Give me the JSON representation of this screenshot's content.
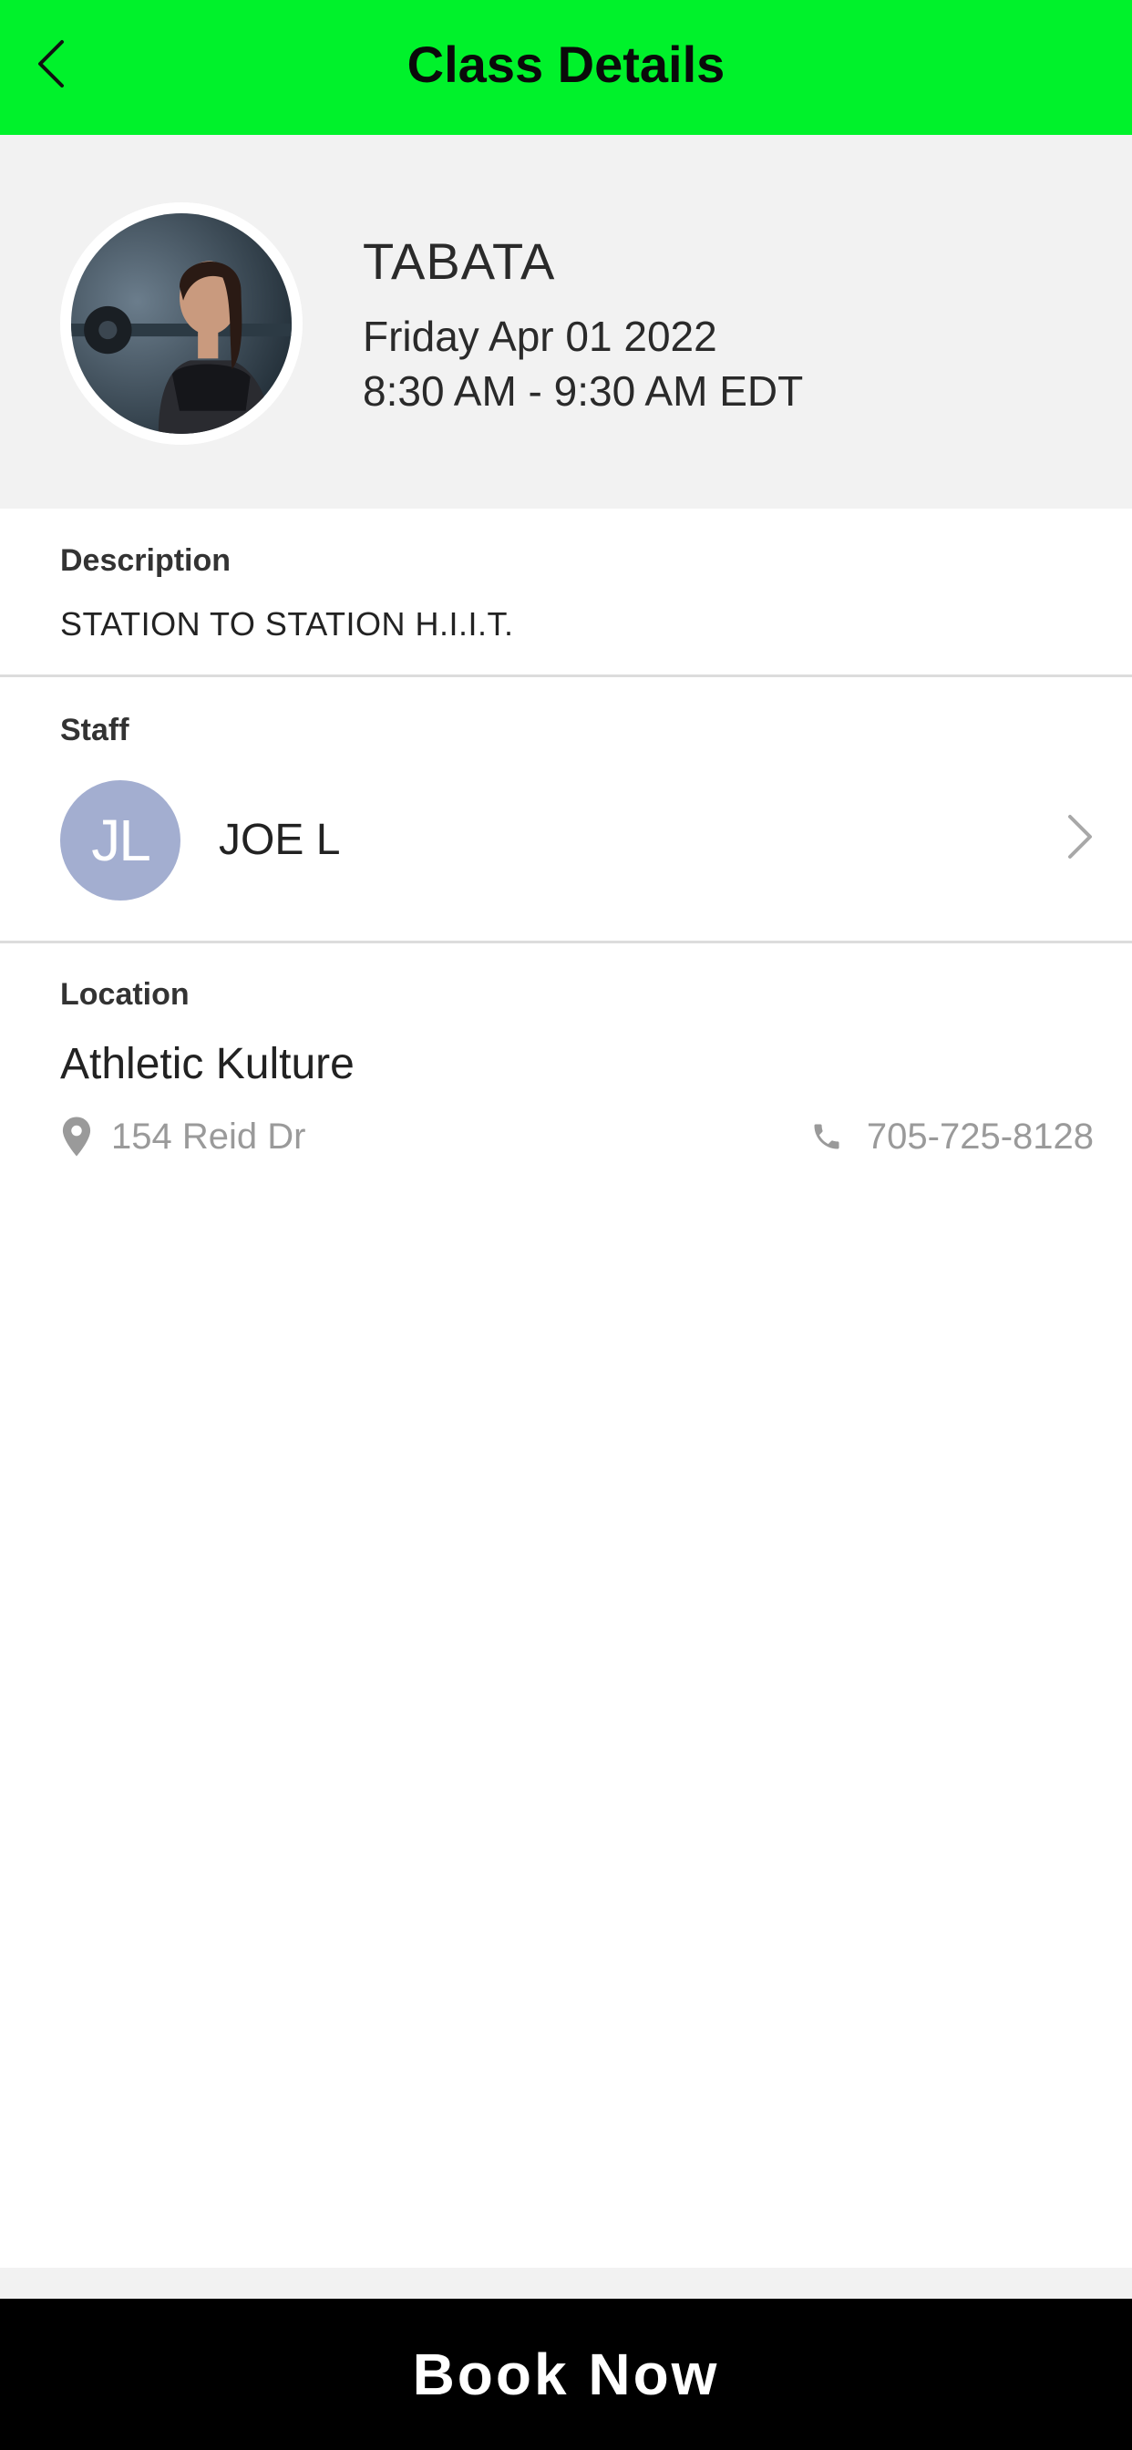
{
  "header": {
    "title": "Class Details",
    "back_icon": "chevron-left-icon",
    "background": "#00f22b"
  },
  "class_info": {
    "name": "TABATA",
    "date": "Friday Apr 01 2022",
    "time": "8:30 AM - 9:30 AM EDT"
  },
  "description": {
    "label": "Description",
    "text": "STATION TO STATION H.I.I.T."
  },
  "staff": {
    "label": "Staff",
    "initials": "JL",
    "name": "JOE L",
    "avatar_color": "#a3aed0"
  },
  "location": {
    "label": "Location",
    "name": "Athletic Kulture",
    "address": "154 Reid Dr",
    "phone": "705-725-8128"
  },
  "footer": {
    "book_label": "Book Now"
  }
}
